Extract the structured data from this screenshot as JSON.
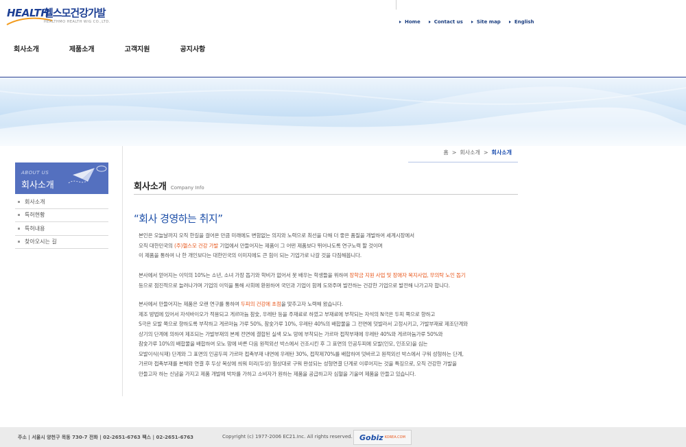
{
  "logo": {
    "brand": "HEALTH",
    "brand_ko": "헬스모건강가발",
    "sub": "HEALTHMO HEALTH WIG CO.,LTD."
  },
  "top_links": [
    "Home",
    "Contact us",
    "Site map",
    "English"
  ],
  "gnb": [
    "회사소개",
    "제품소개",
    "고객지원",
    "공지사항"
  ],
  "sidebar": {
    "title_en": "ABOUT US",
    "title_ko": "회사소개",
    "items": [
      "회사소개",
      "특허현황",
      "특허내용",
      "찾아오시는 길"
    ]
  },
  "breadcrumb": [
    "홈",
    "회사소개",
    "회사소개"
  ],
  "page": {
    "title": "회사소개",
    "title_en": "Company Info",
    "heading": "“회사 경영하는 취지”",
    "p1": {
      "l1": "본인은 오늘날까지 오직 한길을 걸어온 만큼 미래에도 변함없는 의지와 노력으로 최선을 다해 더 좋은 품질을 개발하여 세계시장에서",
      "l2a": "오직 대한민국의 ",
      "l2b": "(주)헬스모 건강 가발",
      "l2c": " 기업에서 만들어지는 제품이 그 어떤 제품보다 뛰어나도록 연구노력 할 것이며",
      "l3": "이 제품을 통하여 나 한 개인보다는 대한민국의 이미지에도 큰 힘이 되는 기업가로 나갈 것을 다짐해봅니다."
    },
    "p2": {
      "l1a": "본사에서 얻어지는 이익의 10%는 소년, 소녀 가장 돕기와 학비가 없어서 못 배우는 학생들을 위하여 ",
      "l1b": "장학금 지원 사업 및 장애자 복지사업, 무의탁 노인 돕기",
      "l2": "등으로 점진적으로 늘려나가며 기업의 이익을 통해 사회에 환원하여 국민과 기업이 함께 도와주며 발전하는 건강한 기업으로 발전해 나가고자 합니다."
    },
    "p3": {
      "l1a": "본사에서 만들어지는 제품은 오랜 연구를 통하여 ",
      "l1b": "두피의 건강에 초점",
      "l1c": "을 맞추고자 노력해 왔습니다.",
      "l2": "제조 방법에 있어서 자석바이오가 적용되고 게르마늄 참숯, 우레탄 등을 주재료로 하였고 부재료에 부착되는 자석의 N극은 두피 쪽으로 향하고",
      "l3": "S극은 모발 쪽으로 향하도록 부착하고 게르마늄 가루 50%, 참숯가루 10%, 우레탄 40%의 배합물을 그 전면에 덧발라서 고정시키고, 가발부재료 제조단계와",
      "l4": "상기의 단계에 의하여 제조되는 가발부재의 본체 전면에 결합된 실색 모노 망에 부착되는 가르마 접착부재에 우레탄 40%와 게르마늄가루 50%와",
      "l5": "참숯가루 10%의 배합물을 배합하여 모노 망에 바른 다음 원적외선 박스에서 건조시킨 후 그 표면의 인공두피에 모발(인모, 인조모)을 심는",
      "l6": "모발이식(식재) 단계와 그 표면의 인공두피 가르마 접촉부재 내면에 우레탄 30%, 접착제70%를 배합하여 덧바르고 원적외선 박스에서 구워 성형하는 단계,",
      "l7": "가르마 접촉부재를 본체와 연결 후 두상 목상에 씌워 미리(두상) 형상대로 구워 완성되는 성형연결 단계로 이루어지는 것을 특징으로, 오직 건강한 가발을",
      "l8": "만들고자 하는 신념을 가지고 제품 개발에 박차를 가하고 소비자가 원하는 제품을 공급하고자 심혈을 기울여 제품을 만들고 있습니다."
    }
  },
  "footer": {
    "address": "주소 | 서울시 양천구 목동 730-7    전화 | 02-2651-6763    팩스 | 02-2651-6763",
    "copyright": "Copyright (c) 1977-2006 EC21.Inc. All rights reserved.",
    "badge": "Gobiz",
    "badge_sub": "KOREA.COM"
  }
}
